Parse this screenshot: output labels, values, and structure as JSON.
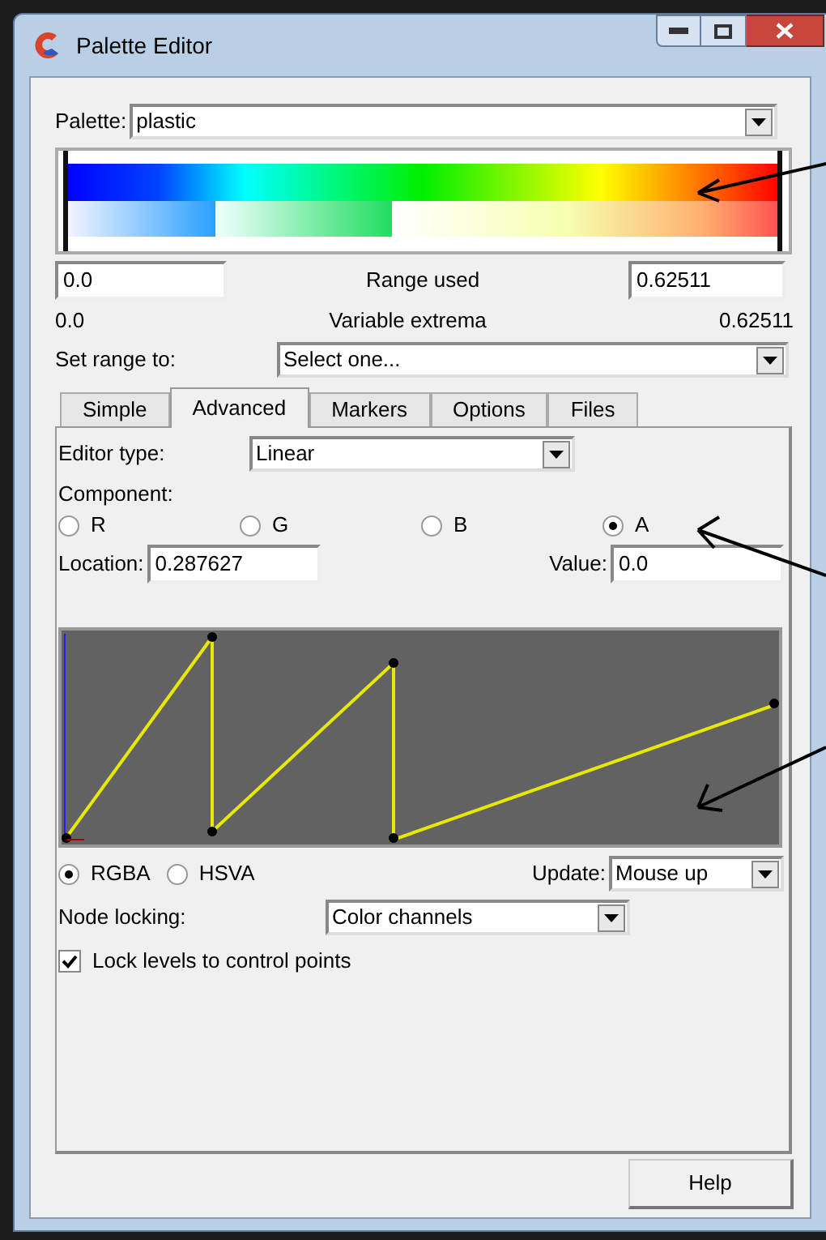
{
  "window": {
    "title": "Palette Editor"
  },
  "palette": {
    "label": "Palette:",
    "value": "plastic"
  },
  "range": {
    "min_value": "0.0",
    "label": "Range used",
    "max_value": "0.62511"
  },
  "extrema": {
    "min": "0.0",
    "label": "Variable extrema",
    "max": "0.62511"
  },
  "set_range": {
    "label": "Set range to:",
    "value": "Select one..."
  },
  "tabs": [
    {
      "label": "Simple",
      "selected": false
    },
    {
      "label": "Advanced",
      "selected": true
    },
    {
      "label": "Markers",
      "selected": false
    },
    {
      "label": "Options",
      "selected": false
    },
    {
      "label": "Files",
      "selected": false
    }
  ],
  "editor_type": {
    "label": "Editor type:",
    "value": "Linear"
  },
  "component": {
    "label": "Component:",
    "options": [
      {
        "label": "R",
        "selected": false
      },
      {
        "label": "G",
        "selected": false
      },
      {
        "label": "B",
        "selected": false
      },
      {
        "label": "A",
        "selected": true
      }
    ]
  },
  "location": {
    "label": "Location:",
    "value": "0.287627"
  },
  "value": {
    "label": "Value:",
    "value": "0.0"
  },
  "color_space": [
    {
      "label": "RGBA",
      "selected": true
    },
    {
      "label": "HSVA",
      "selected": false
    }
  ],
  "update": {
    "label": "Update:",
    "value": "Mouse up"
  },
  "node_locking": {
    "label": "Node locking:",
    "value": "Color channels"
  },
  "lock_levels": {
    "label": "Lock levels to control points",
    "checked": true
  },
  "help_button": "Help"
}
